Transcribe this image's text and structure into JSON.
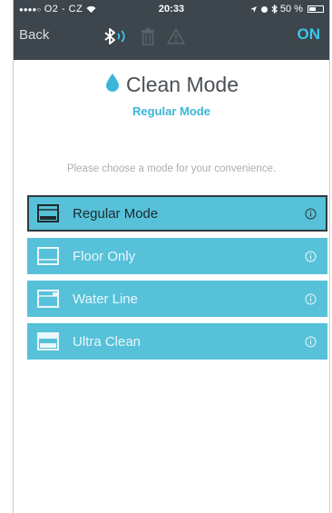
{
  "status": {
    "carrier": "O2 - CZ",
    "signal_dots": "●●●●○",
    "time": "20:33",
    "battery": "50 %",
    "battery_level": 0.5
  },
  "nav": {
    "back_label": "Back",
    "on_label": "ON",
    "icons": [
      "bluetooth-icon",
      "trash-icon",
      "warning-icon"
    ]
  },
  "header": {
    "title": "Clean Mode",
    "subtitle": "Regular Mode"
  },
  "instruction": "Please choose a mode for your convenience.",
  "modes": [
    {
      "label": "Regular Mode",
      "selected": true
    },
    {
      "label": "Floor Only",
      "selected": false
    },
    {
      "label": "Water Line",
      "selected": false
    },
    {
      "label": "Ultra Clean",
      "selected": false
    }
  ],
  "colors": {
    "topbar": "#3c464c",
    "accent": "#3cc6ea",
    "mode_bg": "#56c1d8",
    "title": "#4a4f55"
  }
}
